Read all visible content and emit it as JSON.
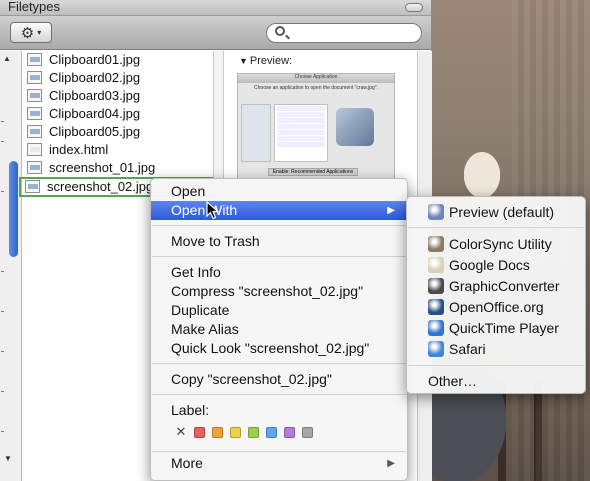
{
  "window": {
    "title": "Filetypes"
  },
  "toolbar": {
    "action_icon": "⚙",
    "action_caret": "▾"
  },
  "sidebar_scroll": {
    "up_arrow": "▲",
    "down_arrow": "▼"
  },
  "files": [
    {
      "name": "Clipboard01.jpg"
    },
    {
      "name": "Clipboard02.jpg"
    },
    {
      "name": "Clipboard03.jpg"
    },
    {
      "name": "Clipboard04.jpg"
    },
    {
      "name": "Clipboard05.jpg"
    },
    {
      "name": "index.html"
    },
    {
      "name": "screenshot_01.jpg"
    },
    {
      "name": "screenshot_02.jpg"
    }
  ],
  "preview": {
    "label": "Preview:",
    "thumb_title": "Choose Application",
    "thumb_subtitle": "Choose an application to open the document \"craw.jpg\":",
    "thumb_enable": "Enable: Recommended Applications"
  },
  "context_menu": {
    "open": "Open",
    "open_with": "Open With",
    "move_to_trash": "Move to Trash",
    "get_info": "Get Info",
    "compress": "Compress \"screenshot_02.jpg\"",
    "duplicate": "Duplicate",
    "make_alias": "Make Alias",
    "quick_look": "Quick Look \"screenshot_02.jpg\"",
    "copy": "Copy \"screenshot_02.jpg\"",
    "label": "Label:",
    "label_clear": "✕",
    "more": "More",
    "submenu_arrow": "▶",
    "label_colors": [
      "#e8605a",
      "#f2a23a",
      "#eed14a",
      "#9ccf4e",
      "#5ea8ea",
      "#b77ad8",
      "#a6a6a6"
    ]
  },
  "open_with_menu": {
    "apps": [
      {
        "name": "Preview (default)",
        "icon": "preview-icon",
        "color": "#6f86b8"
      },
      {
        "name": "ColorSync Utility",
        "icon": "colorsync-icon",
        "color": "#8a7a66"
      },
      {
        "name": "Google Docs",
        "icon": "google-docs-icon",
        "color": "#d8d0b8"
      },
      {
        "name": "GraphicConverter",
        "icon": "graphicconverter-icon",
        "color": "#4a4a4a"
      },
      {
        "name": "OpenOffice.org",
        "icon": "openoffice-icon",
        "color": "#2b4f84"
      },
      {
        "name": "QuickTime Player",
        "icon": "quicktime-icon",
        "color": "#2f74d0"
      },
      {
        "name": "Safari",
        "icon": "safari-icon",
        "color": "#3f86d8"
      }
    ],
    "other": "Other…"
  }
}
